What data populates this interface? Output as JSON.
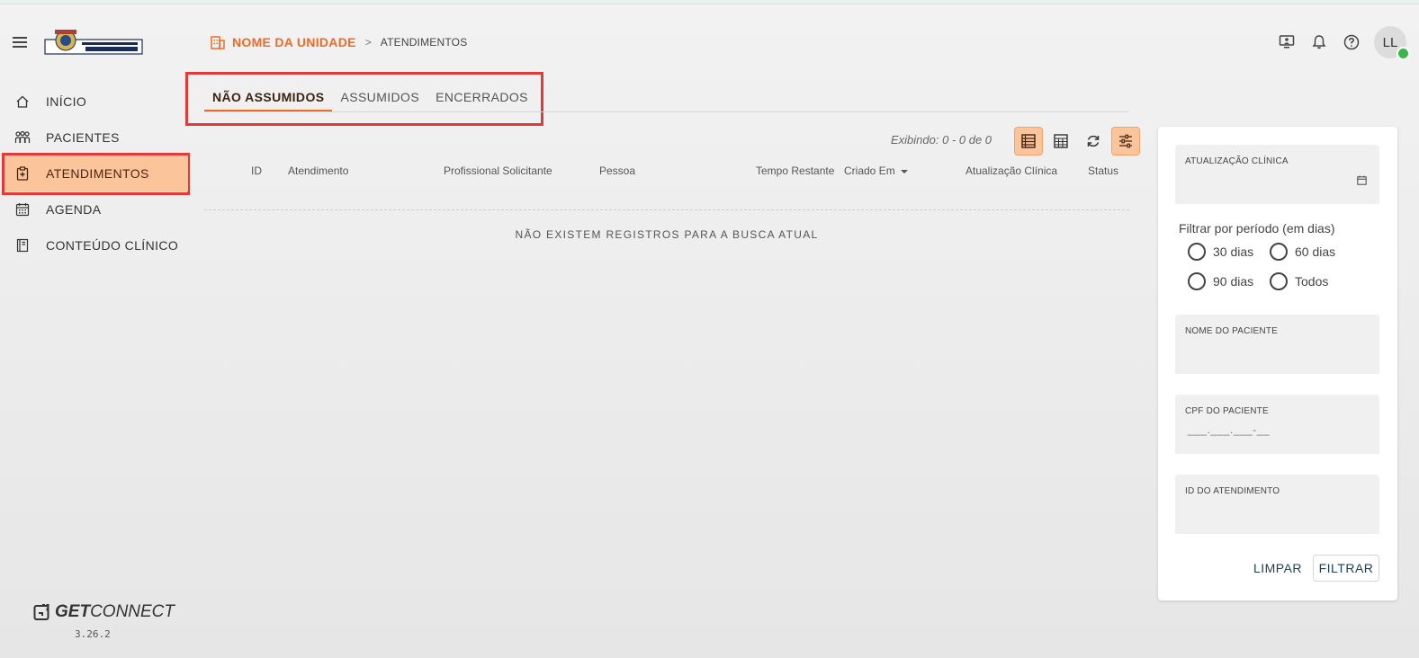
{
  "header": {
    "logo_alt": "CIDADE DE GUARULHOS",
    "breadcrumb": {
      "unit": "NOME DA UNIDADE",
      "separator": ">",
      "current": "ATENDIMENTOS"
    },
    "icons": [
      "computer-user-icon",
      "bell-icon",
      "help-icon"
    ],
    "avatar_initials": "LL"
  },
  "sidebar": {
    "items": [
      {
        "label": "INÍCIO",
        "icon": "home-icon"
      },
      {
        "label": "PACIENTES",
        "icon": "patients-icon"
      },
      {
        "label": "ATENDIMENTOS",
        "icon": "clipboard-icon",
        "active": true
      },
      {
        "label": "AGENDA",
        "icon": "calendar-icon"
      },
      {
        "label": "CONTEÚDO CLÍNICO",
        "icon": "book-icon"
      }
    ],
    "brand_bold": "GET",
    "brand_light": "CONNECT",
    "version": "3.26.2"
  },
  "tabs": [
    {
      "label": "NÃO ASSUMIDOS",
      "active": true
    },
    {
      "label": "ASSUMIDOS"
    },
    {
      "label": "ENCERRADOS"
    }
  ],
  "toolbar": {
    "display_text": "Exibindo: 0 - 0 de 0",
    "buttons": [
      "list-view-icon",
      "grid-view-icon",
      "refresh-icon",
      "filter-icon"
    ]
  },
  "table": {
    "columns": [
      "ID",
      "Atendimento",
      "Profissional Solicitante",
      "Pessoa",
      "Tempo Restante",
      "Criado Em",
      "Atualização Clínica",
      "Status"
    ],
    "empty_message": "NÃO EXISTEM REGISTROS PARA A BUSCA ATUAL"
  },
  "filters": {
    "clinical_update_label": "ATUALIZAÇÃO CLÍNICA",
    "period_title": "Filtrar por período (em dias)",
    "period_options": [
      "30 dias",
      "60 dias",
      "90 dias",
      "Todos"
    ],
    "patient_name_label": "NOME DO PACIENTE",
    "patient_cpf_label": "CPF DO PACIENTE",
    "patient_cpf_placeholder": "___.___.___-__",
    "attendance_id_label": "ID DO ATENDIMENTO",
    "clear_label": "LIMPAR",
    "filter_label": "FILTRAR"
  },
  "colors": {
    "accent": "#f06a24",
    "active_bg": "#fcc49b",
    "highlight_frame": "#e03a3a",
    "button_text": "#1e3e58"
  }
}
